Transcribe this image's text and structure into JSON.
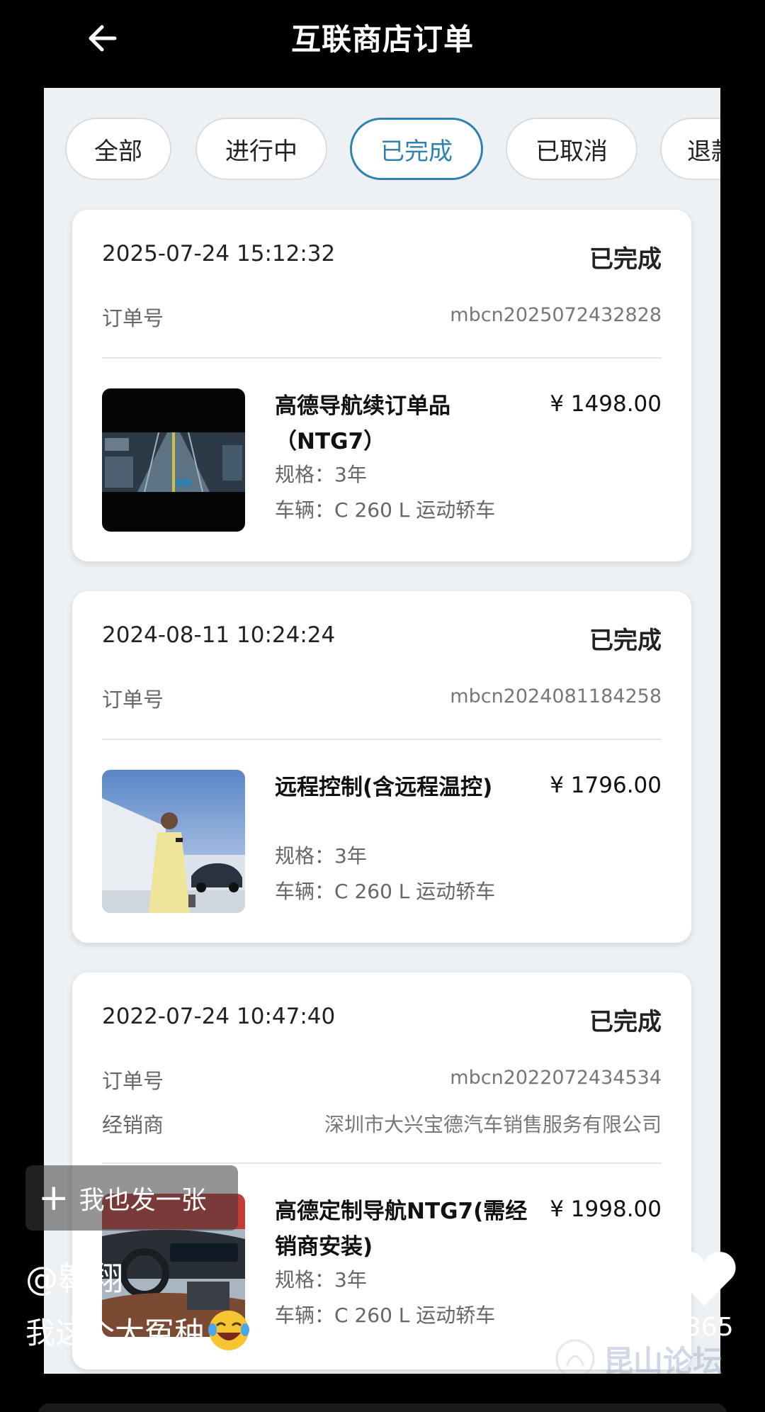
{
  "header": {
    "title": "互联商店订单"
  },
  "tabs": [
    {
      "label": "全部",
      "active": false
    },
    {
      "label": "进行中",
      "active": false
    },
    {
      "label": "已完成",
      "active": true
    },
    {
      "label": "已取消",
      "active": false
    },
    {
      "label": "退款",
      "active": false
    }
  ],
  "orders": [
    {
      "time": "2025-07-24 15:12:32",
      "status": "已完成",
      "order_label": "订单号",
      "order_no": "mbcn2025072432828",
      "product_name_line1": "高德导航续订单品",
      "product_name_line2": "（NTG7）",
      "price": "¥ 1498.00",
      "spec": "规格：3年",
      "vehicle": "车辆：C 260 L 运动轿车",
      "thumb_icon": "navigation-screen-image"
    },
    {
      "time": "2024-08-11 10:24:24",
      "status": "已完成",
      "order_label": "订单号",
      "order_no": "mbcn2024081184258",
      "product_name_line1": "远程控制(含远程温控)",
      "price": "¥ 1796.00",
      "spec": "规格：3年",
      "vehicle": "车辆：C 260 L 运动轿车",
      "thumb_icon": "woman-with-car-image"
    },
    {
      "time": "2022-07-24 10:47:40",
      "status": "已完成",
      "order_label": "订单号",
      "order_no": "mbcn2022072434534",
      "dealer_label": "经销商",
      "dealer": "深圳市大兴宝德汽车销售服务有限公司",
      "product_name_line1": "高德定制导航NTG7(需经",
      "product_name_line2": "销商安装)",
      "price": "¥ 1998.00",
      "spec": "规格：3年",
      "vehicle": "车辆：C 260 L 运动轿车",
      "thumb_icon": "car-interior-image"
    }
  ],
  "overlay": {
    "post_button": "我也发一张",
    "author": "@翱翔",
    "caption": "我这个大冤种",
    "like_count": "6365",
    "watermark": "昆山论坛"
  },
  "colors": {
    "accent": "#2f82b0",
    "panel_bg": "#eef1f3"
  }
}
